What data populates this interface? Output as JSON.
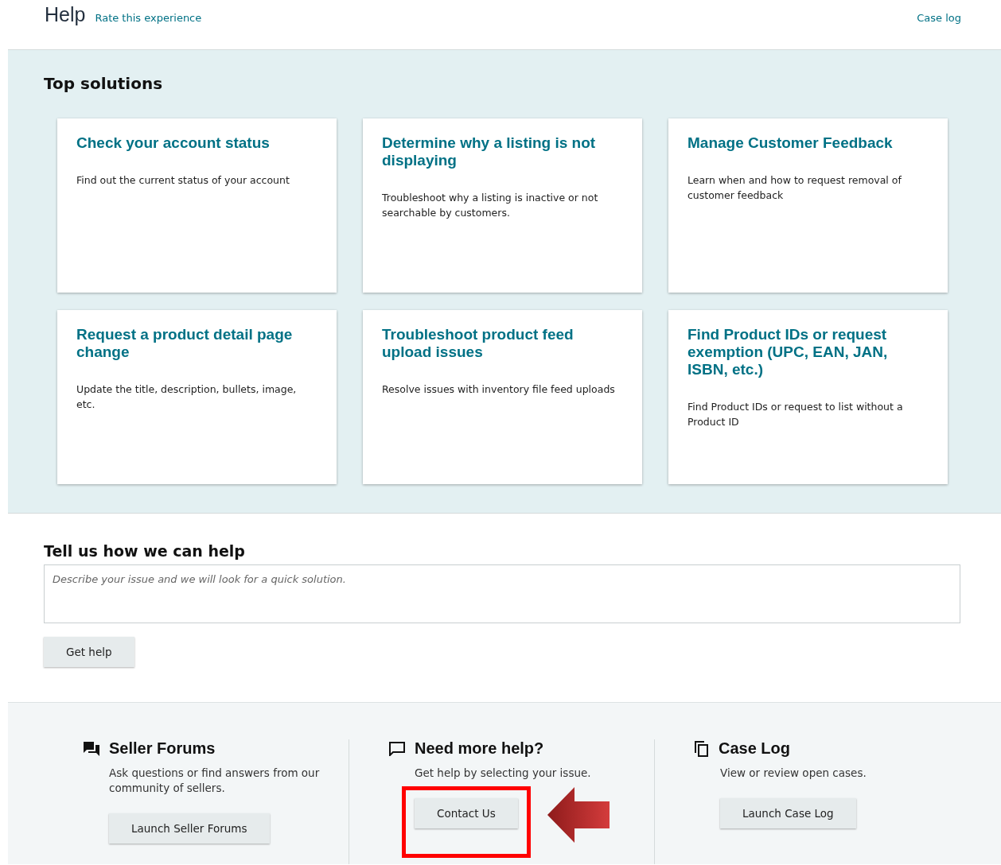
{
  "header": {
    "title": "Help",
    "rate_link": "Rate this experience",
    "case_log_link": "Case log"
  },
  "top_solutions": {
    "heading": "Top solutions",
    "cards": [
      {
        "title": "Check your account status",
        "description": "Find out the current status of your account"
      },
      {
        "title": "Determine why a listing is not displaying",
        "description": "Troubleshoot why a listing is inactive or not searchable by customers."
      },
      {
        "title": "Manage Customer Feedback",
        "description": "Learn when and how to request removal of customer feedback"
      },
      {
        "title": "Request a product detail page change",
        "description": "Update the title, description, bullets, image, etc."
      },
      {
        "title": "Troubleshoot product feed upload issues",
        "description": "Resolve issues with inventory file feed uploads"
      },
      {
        "title": "Find Product IDs or request exemption (UPC, EAN, JAN, ISBN, etc.)",
        "description": "Find Product IDs or request to list without a Product ID"
      }
    ]
  },
  "help_form": {
    "heading": "Tell us how we can help",
    "placeholder": "Describe your issue and we will look for a quick solution.",
    "button": "Get help"
  },
  "footer_columns": [
    {
      "kind": "forums",
      "title": "Seller Forums",
      "description": "Ask questions or find answers from our community of sellers.",
      "button": "Launch Seller Forums",
      "highlighted": false
    },
    {
      "kind": "contact",
      "title": "Need more help?",
      "description": "Get help by selecting your issue.",
      "button": "Contact Us",
      "highlighted": true
    },
    {
      "kind": "caselog",
      "title": "Case Log",
      "description": "View or review open cases.",
      "button": "Launch Case Log",
      "highlighted": false
    }
  ]
}
